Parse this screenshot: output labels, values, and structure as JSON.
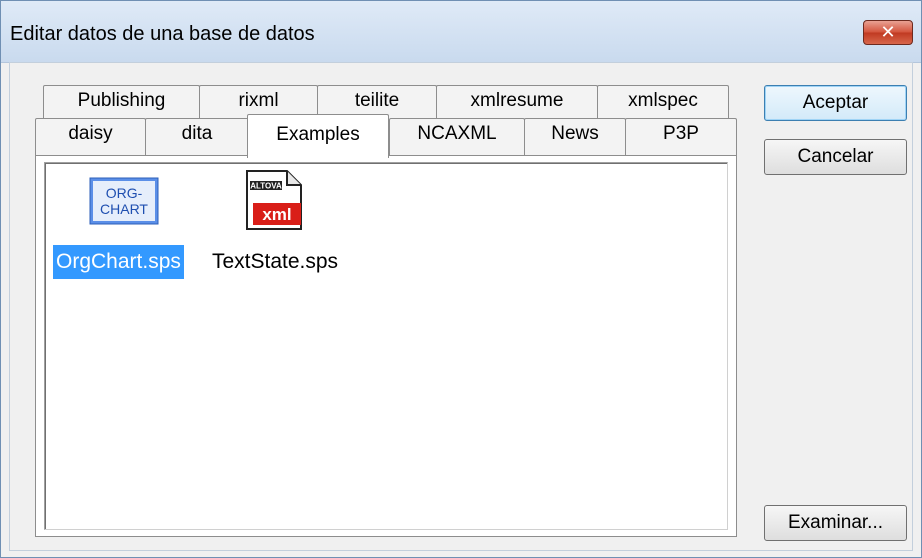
{
  "window": {
    "title": "Editar datos de una base de datos"
  },
  "tabs": {
    "row1": [
      "Publishing",
      "rixml",
      "teilite",
      "xmlresume",
      "xmlspec"
    ],
    "row2": [
      "daisy",
      "dita",
      "Examples",
      "NCAXML",
      "News",
      "P3P"
    ],
    "active": "Examples"
  },
  "files": [
    {
      "name": "OrgChart.sps",
      "icon": "orgchart-icon",
      "icon_text_line1": "ORG-",
      "icon_text_line2": "CHART",
      "selected": true
    },
    {
      "name": "TextState.sps",
      "icon": "altova-xml-icon",
      "icon_brand": "ALTOVA",
      "icon_badge": "xml",
      "selected": false
    }
  ],
  "buttons": {
    "ok": "Aceptar",
    "cancel": "Cancelar",
    "browse": "Examinar..."
  },
  "colors": {
    "selection": "#3399ff",
    "title_bg": "#dfeaf7",
    "close_red": "#c8432b",
    "xml_red": "#d91e18"
  }
}
